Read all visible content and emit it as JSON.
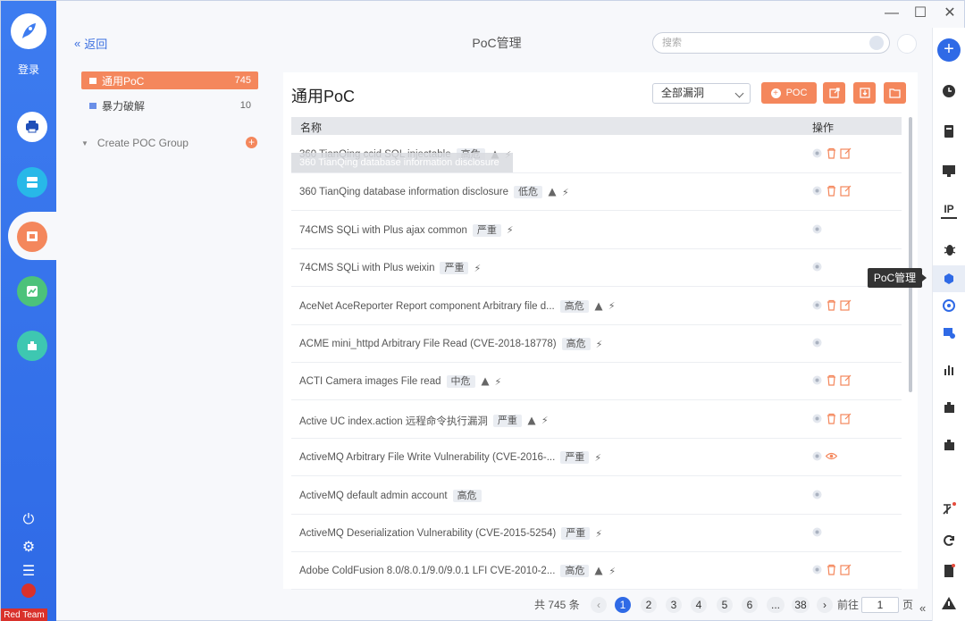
{
  "nav": {
    "login": "登录",
    "footer_badge": "Red Team"
  },
  "header": {
    "back": "返回",
    "title": "PoC管理",
    "search_placeholder": "搜索"
  },
  "sidebar": {
    "groups": [
      {
        "label": "通用PoC",
        "count": "745"
      },
      {
        "label": "暴力破解",
        "count": "10"
      }
    ],
    "create_group": "Create POC Group"
  },
  "main": {
    "title": "通用PoC",
    "filter_selected": "全部漏洞",
    "poc_button": "POC",
    "columns": [
      "名称",
      "操作"
    ],
    "hover_tooltip": "360 TianQing database information disclosure",
    "rows": [
      {
        "name": "360 TianQing ccid SQL injectable",
        "severity": "高危",
        "warn": true,
        "ops": "full"
      },
      {
        "name": "360 TianQing database information disclosure",
        "severity": "低危",
        "warn": true,
        "ops": "full"
      },
      {
        "name": "74CMS SQLi with Plus ajax common",
        "severity": "严重",
        "warn": false,
        "ops": "min"
      },
      {
        "name": "74CMS SQLi with Plus weixin",
        "severity": "严重",
        "warn": false,
        "ops": "min"
      },
      {
        "name": "AceNet AceReporter Report component Arbitrary file d...",
        "severity": "高危",
        "warn": true,
        "ops": "full"
      },
      {
        "name": "ACME mini_httpd Arbitrary File Read (CVE-2018-18778)",
        "severity": "高危",
        "warn": false,
        "ops": "min"
      },
      {
        "name": "ACTI Camera images File read",
        "severity": "中危",
        "warn": true,
        "ops": "full"
      },
      {
        "name": "Active UC index.action 远程命令执行漏洞",
        "severity": "严重",
        "warn": true,
        "ops": "full"
      },
      {
        "name": "ActiveMQ Arbitrary File Write Vulnerability (CVE-2016-...",
        "severity": "严重",
        "warn": false,
        "ops": "view"
      },
      {
        "name": "ActiveMQ default admin account",
        "severity": "高危",
        "warn": false,
        "bolt": false,
        "ops": "min"
      },
      {
        "name": "ActiveMQ Deserialization Vulnerability (CVE-2015-5254)",
        "severity": "严重",
        "warn": false,
        "ops": "min"
      },
      {
        "name": "Adobe ColdFusion 8.0/8.0.1/9.0/9.0.1 LFI CVE-2010-2...",
        "severity": "高危",
        "warn": true,
        "ops": "full"
      }
    ]
  },
  "pagination": {
    "total": "共 745 条",
    "pages": [
      "1",
      "2",
      "3",
      "4",
      "5",
      "6",
      "...",
      "38"
    ],
    "current": "1",
    "goto_label": "前往",
    "goto_value": "1",
    "page_suffix": "页"
  },
  "rightbar": {
    "tooltip": "PoC管理",
    "ip_label": "IP"
  },
  "colors": {
    "primary": "#2f6ae6",
    "accent": "#f4875c"
  }
}
